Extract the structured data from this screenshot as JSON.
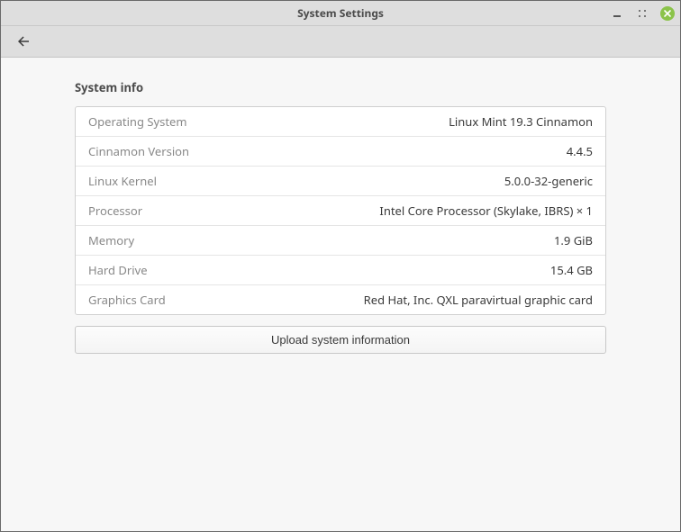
{
  "window": {
    "title": "System Settings"
  },
  "section": {
    "title": "System info"
  },
  "info": {
    "rows": [
      {
        "label": "Operating System",
        "value": "Linux Mint 19.3 Cinnamon"
      },
      {
        "label": "Cinnamon Version",
        "value": "4.4.5"
      },
      {
        "label": "Linux Kernel",
        "value": "5.0.0-32-generic"
      },
      {
        "label": "Processor",
        "value": "Intel Core Processor (Skylake, IBRS) × 1"
      },
      {
        "label": "Memory",
        "value": "1.9 GiB"
      },
      {
        "label": "Hard Drive",
        "value": "15.4 GB"
      },
      {
        "label": "Graphics Card",
        "value": "Red Hat, Inc. QXL paravirtual graphic card"
      }
    ]
  },
  "actions": {
    "upload_label": "Upload system information"
  }
}
